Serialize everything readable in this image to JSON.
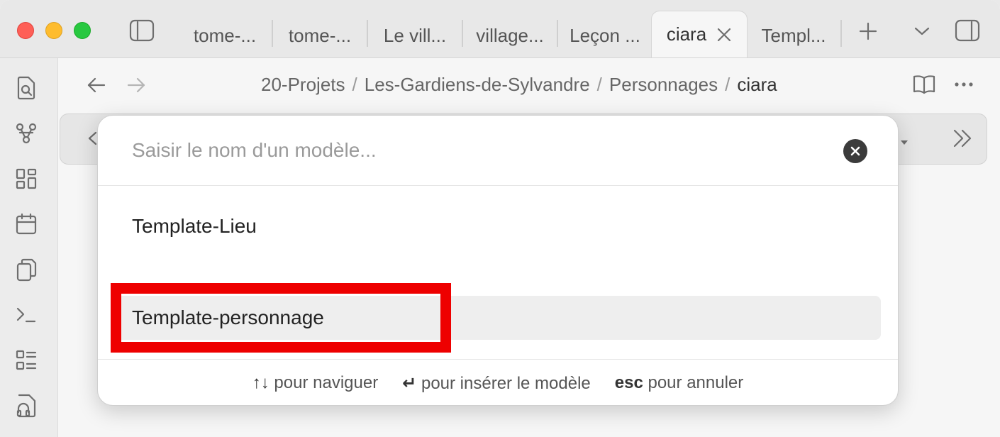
{
  "tabs": [
    {
      "label": "tome-..."
    },
    {
      "label": "tome-..."
    },
    {
      "label": "Le vill..."
    },
    {
      "label": "village..."
    },
    {
      "label": "Leçon ..."
    },
    {
      "label": "ciara",
      "active": true
    },
    {
      "label": "Templ..."
    }
  ],
  "breadcrumb": {
    "items": [
      "20-Projets",
      "Les-Gardiens-de-Sylvandre",
      "Personnages",
      "ciara"
    ],
    "separator": "/"
  },
  "modal": {
    "placeholder": "Saisir le nom d'un modèle...",
    "value": "",
    "suggestions": [
      {
        "label": "Template-Lieu",
        "selected": false
      },
      {
        "label": "Template-personnage",
        "selected": true
      }
    ],
    "footer": {
      "navigate_keys": "↑↓",
      "navigate_label": "pour naviguer",
      "insert_key": "↵",
      "insert_label": "pour insérer le modèle",
      "cancel_key": "esc",
      "cancel_label": "pour annuler"
    }
  },
  "ribbon_icons": [
    "search-icon",
    "graph-icon",
    "dashboard-icon",
    "calendar-icon",
    "copy-icon",
    "terminal-icon",
    "list-icon",
    "headphones-icon"
  ],
  "colors": {
    "highlight": "#ee0000",
    "close": "#fe5f57",
    "minimize": "#febc2e",
    "maximize": "#28c840"
  }
}
